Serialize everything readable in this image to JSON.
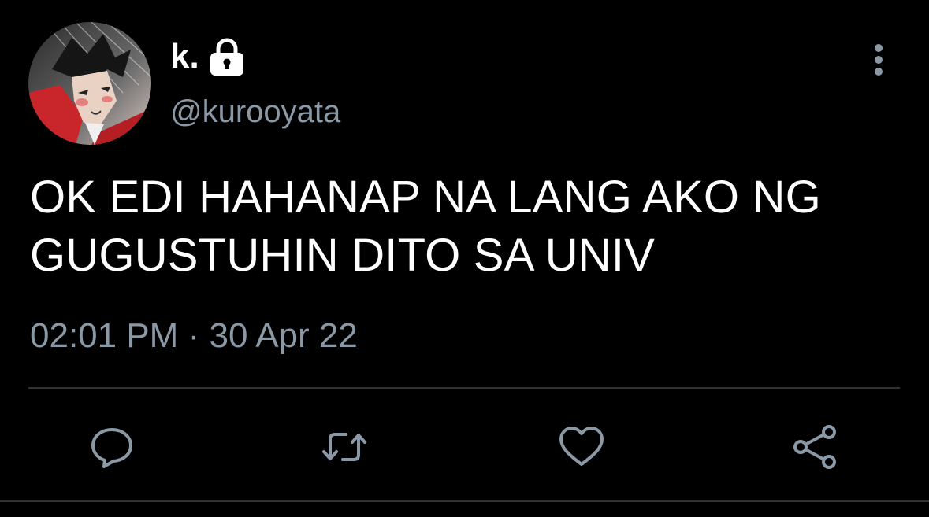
{
  "tweet": {
    "author": {
      "display_name": "k.",
      "handle": "@kurooyata",
      "protected_icon": "lock-icon",
      "avatar": "anime-character-avatar"
    },
    "text": "OK EDI HAHANAP NA LANG AKO NG\nGUGUSTUHIN DITO SA UNIV",
    "time": "02:01 PM",
    "separator": "·",
    "date": "30 Apr 22"
  },
  "menu": {
    "icon": "more-vertical-icon"
  },
  "actions": [
    {
      "icon": "reply-icon"
    },
    {
      "icon": "retweet-icon"
    },
    {
      "icon": "like-icon"
    },
    {
      "icon": "share-icon"
    }
  ],
  "colors": {
    "background": "#000000",
    "text_primary": "#ffffff",
    "text_secondary": "#8b98a5",
    "divider": "#2f3336"
  }
}
